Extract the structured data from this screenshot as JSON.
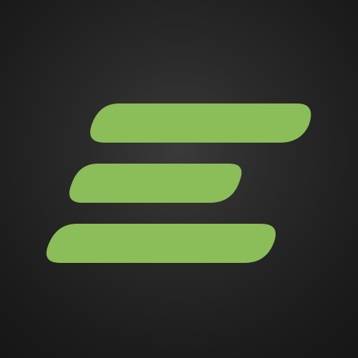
{
  "app_icon": {
    "icon_name": "three-slanted-bars-logo-icon",
    "colors": {
      "background": "#1f1f1f",
      "accent": "#8bbd58"
    },
    "bars": [
      {
        "name": "top-bar"
      },
      {
        "name": "middle-bar"
      },
      {
        "name": "bottom-bar"
      }
    ]
  }
}
